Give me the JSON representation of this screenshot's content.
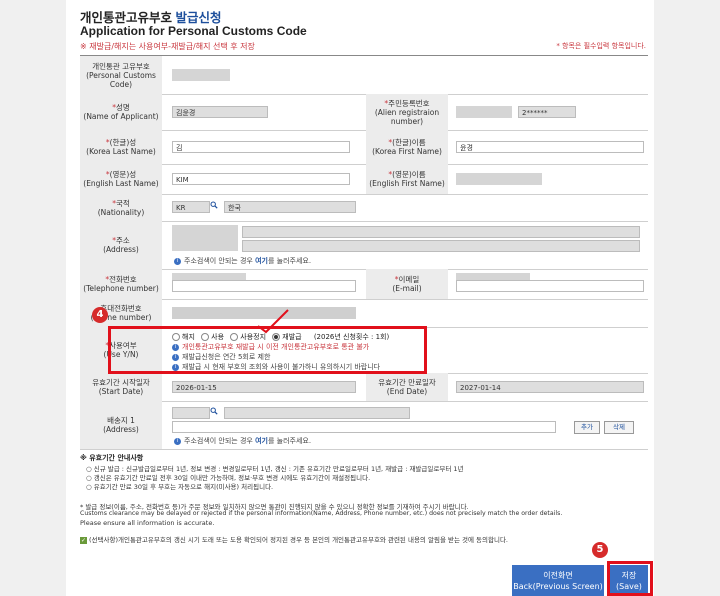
{
  "header": {
    "title_ko_main": "개인통관고유부호",
    "title_ko_accent": "발급신청",
    "title_en": "Application for Personal Customs Code",
    "notice": "※ 재발급/해지는 사용여부-재발급/해지 선택 후 저장",
    "required_note": "* 항목은 필수입력 항목입니다."
  },
  "fields": {
    "customs_code_label": "개인통관 고유부호\n(Personal Customs Code)",
    "name_label": "성명",
    "name_label_en": "(Name of Applicant)",
    "name_value": "김윤경",
    "rrn_label": "주민등록번호",
    "rrn_label_en": "(Alien registraion number)",
    "rrn_value": "2******",
    "last_ko_label": "(한글)성",
    "last_ko_label_en": "(Korea Last Name)",
    "last_ko_value": "김",
    "first_ko_label": "(한글)이름",
    "first_ko_label_en": "(Korea First Name)",
    "first_ko_value": "윤경",
    "last_en_label": "(영문)성",
    "last_en_label_en": "(English Last Name)",
    "last_en_value": "KIM",
    "first_en_label": "(영문)이름",
    "first_en_label_en": "(English First Name)",
    "nat_label": "국적",
    "nat_label_en": "(Nationality)",
    "nat_code": "KR",
    "nat_name": "한국",
    "addr_label": "주소",
    "addr_label_en": "(Address)",
    "addr_hint_pre": "주소검색이 안되는 경우",
    "addr_hint_link": "여기",
    "addr_hint_post": "를 눌러주세요.",
    "tel_label": "전화번호",
    "tel_label_en": "(Telephone number)",
    "email_label": "이메일",
    "email_label_en": "(E-mail)",
    "mobile_label": "휴대전화번호",
    "mobile_label_en": "(Phone number)",
    "use_label": "사용여부",
    "use_label_en": "(Use Y/N)",
    "use_options": [
      "해지",
      "사용",
      "사용정지",
      "재발급"
    ],
    "reissue_count": "(2026년 신청횟수 : 1회)",
    "use_msg1": "개인통관고유부호 재발급 시 이전 개인통관고유부호로 통관 불가",
    "use_msg2": "재발급신청은 연간 5회로 제한",
    "use_msg3": "재발급 시 현재 부호의 조회와 사용이 불가하니 유의하시기 바랍니다",
    "start_label": "유효기간 시작일자",
    "start_label_en": "(Start Date)",
    "start_value": "2026-01-15",
    "end_label": "유효기간 만료일자",
    "end_label_en": "(End Date)",
    "end_value": "2027-01-14",
    "ship_label": "배송지 1",
    "ship_label_en": "(Address)",
    "add_btn": "추가",
    "del_btn": "삭제"
  },
  "validity": {
    "title": "※ 유효기간 안내사항",
    "line1": "○ 신규 발급 : 신규발급일로부터 1년, 정보 변경 : 변경일로부터 1년, 갱신 : 기존 유효기간 만료일로부터 1년, 재발급 : 재발급일로부터 1년",
    "line2": "○ 갱신은 유효기간 만료일 전후 30일 이내만 가능하며, 정보·부호 변경 시에도 유효기간이 재설정됩니다.",
    "line3": "○ 유효기간 만료 30일 후 부호는 자동으로 해지(미사용) 처리됩니다."
  },
  "footer": {
    "warn_ko": "* 발급 정보(이름, 주소, 전화번호 등)가 주문 정보와 일치하지 않으면 통관이 진행되지 않을 수 있으니 정확한 정보를 기재하여 주시기 바랍니다.",
    "warn_en1": "Customs clearance may be delayed or rejected if the personal information(Name, Address, Phone number, etc.) does not precisely match the order details.",
    "warn_en2": "Please ensure all information is accurate.",
    "consent": "(선택사항)개인통관고유부호의 갱신 시기 도래 또는 도용 확인되어 정지된 경우 등 본인의 개인통관고유부호와 관련된 내용의 알림을 받는 것에 동의합니다."
  },
  "buttons": {
    "back_ko": "이전화면",
    "back_en": "Back(Previous Screen)",
    "save_ko": "저장",
    "save_en": "(Save)"
  },
  "markers": {
    "badge4": "4",
    "badge5": "5"
  },
  "colors": {
    "accent": "#1d4f9c",
    "button": "#3a6fc2",
    "highlight": "#e1101b"
  }
}
